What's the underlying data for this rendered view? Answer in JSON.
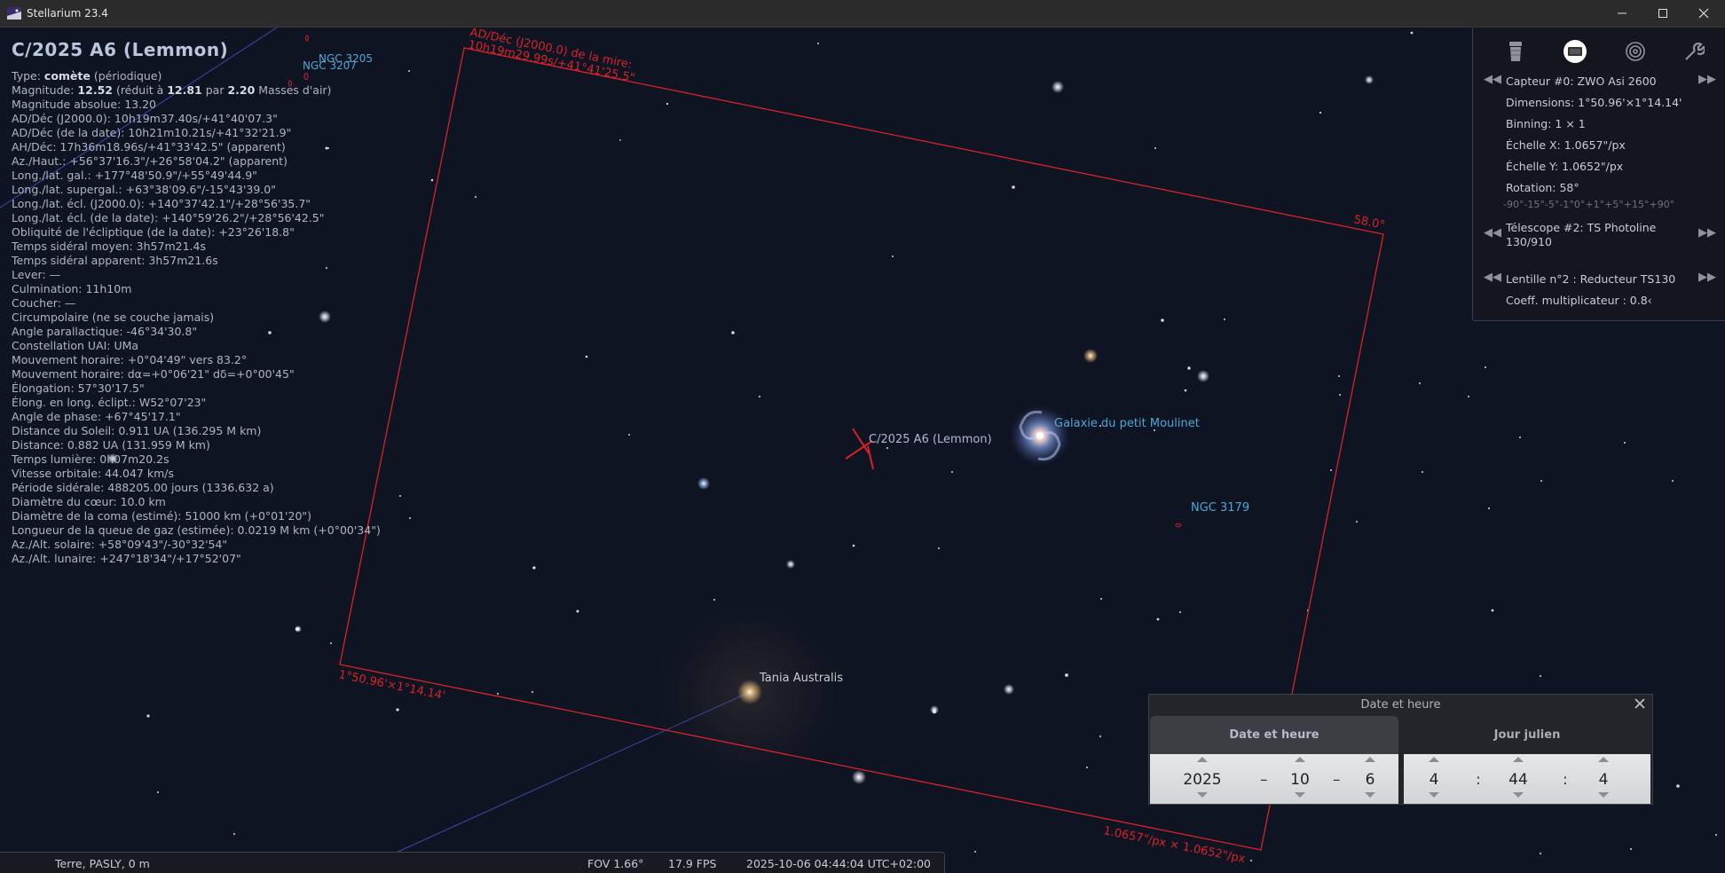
{
  "window": {
    "title": "Stellarium 23.4",
    "minimize": "—",
    "maximize": "☐",
    "close": "✕"
  },
  "object": {
    "title": "C/2025 A6 (Lemmon)",
    "lines": [
      [
        "Type: ",
        "comète",
        " (périodique)"
      ],
      [
        "Magnitude: ",
        "12.52",
        " (réduit à ",
        "12.81",
        " par ",
        "2.20",
        " Masses d'air)"
      ],
      [
        "Magnitude absolue: 13.20"
      ],
      [
        "AD/Déc (J2000.0): 10h19m37.40s/+41°40'07.3\""
      ],
      [
        "AD/Déc (de la date): 10h21m10.21s/+41°32'21.9\""
      ],
      [
        "AH/Déc: 17h36m18.96s/+41°33'42.5\" (apparent)"
      ],
      [
        "Az./Haut.: +56°37'16.3\"/+26°58'04.2\" (apparent)"
      ],
      [
        "Long./lat. gal.: +177°48'50.9\"/+55°49'44.9\""
      ],
      [
        "Long./lat. supergal.: +63°38'09.6\"/-15°43'39.0\""
      ],
      [
        "Long./lat. écl. (J2000.0): +140°37'42.1\"/+28°56'35.7\""
      ],
      [
        "Long./lat. écl. (de la date): +140°59'26.2\"/+28°56'42.5\""
      ],
      [
        "Obliquité de l'écliptique (de la date): +23°26'18.8\""
      ],
      [
        "Temps sidéral moyen: 3h57m21.4s"
      ],
      [
        "Temps sidéral apparent: 3h57m21.6s"
      ],
      [
        "Lever: —"
      ],
      [
        "Culmination: 11h10m"
      ],
      [
        "Coucher: —"
      ],
      [
        "Circumpolaire (ne se couche jamais)"
      ],
      [
        "Angle parallactique: -46°34'30.8\""
      ],
      [
        "Constellation UAI: UMa"
      ],
      [
        "Mouvement horaire: +0°04'49\" vers 83.2°"
      ],
      [
        "Mouvement horaire: dα=+0°06'21\" dδ=+0°00'45\""
      ],
      [
        "Élongation: 57°30'17.5\""
      ],
      [
        "Élong. en long. éclipt.: W52°07'23\""
      ],
      [
        "Angle de phase: +67°45'17.1\""
      ],
      [
        "Distance du Soleil: 0.911 UA (136.295 M km)"
      ],
      [
        "Distance: 0.882 UA (131.959 M km)"
      ],
      [
        "Temps lumière: 0h07m20.2s"
      ],
      [
        "Vitesse orbitale: 44.047 km/s"
      ],
      [
        "Période sidérale: 488205.00 jours (1336.632 a)"
      ],
      [
        "Diamètre du cœur: 10.0 km"
      ],
      [
        "Diamètre de la coma (estimé): 51000 km (+0°01'20\")"
      ],
      [
        "Longueur de la queue de gaz (estimée): 0.0219 M km (+0°00'34\")"
      ],
      [
        "Az./Alt. solaire: +58°09'43\"/-30°32'54\""
      ],
      [
        "Az./Alt. lunaire: +247°18'34\"/+17°52'07\""
      ]
    ]
  },
  "sky": {
    "labels": {
      "ngc3205": "NGC 3205",
      "ngc3207": "NGC 3207",
      "comet": "C/2025 A6 (Lemmon)",
      "galaxy": "Galaxie du petit Moulinet",
      "ngc3179": "NGC 3179",
      "tania": "Tania Australis"
    },
    "frame": {
      "target_line1": "AD/Déc (J2000.0) de la mire:",
      "target_line2": "10h19m29.99s/+41°41'25.5\"",
      "rotation": "58.0°",
      "dimensions": "1°50.96'×1°14.14'",
      "scale": "1.0657\"/px × 1.0652\"/px"
    },
    "colors": {
      "frame": "#d8222a",
      "dso_label": "#4ea6d6",
      "star_label": "#c8ccd4",
      "line": "#3b4aa8"
    }
  },
  "oculars": {
    "icons": [
      "ocular-icon",
      "ccd-icon",
      "telrad-icon",
      "wrench-icon"
    ],
    "sensor": "Capteur #0: ZWO Asi 2600",
    "dimensions": "Dimensions: 1°50.96'×1°14.14'",
    "binning": "Binning: 1 × 1",
    "scale_x": "Échelle X: 1.0657\"/px",
    "scale_y": "Échelle Y: 1.0652\"/px",
    "rotation": "Rotation: 58°",
    "rotation_scale": "-90°-15°-5°-1°0°+1°+5°+15°+90°",
    "telescope_line1": "Télescope #2: TS Photoline",
    "telescope_line2": "130/910",
    "lens": "Lentille n°2 : Reducteur TS130",
    "multiplier": "Coeff. multiplicateur : 0.8‹"
  },
  "date_dialog": {
    "title": "Date et heure",
    "tab_date": "Date et heure",
    "tab_julian": "Jour julien",
    "year": "2025",
    "month": "10",
    "day": "6",
    "hour": "4",
    "minute": "44",
    "second": "4",
    "date_sep": "–",
    "time_sep": ":",
    "close": "✕"
  },
  "status": {
    "location": "Terre, PASLY, 0 m",
    "fov": "FOV 1.66°",
    "fps": "17.9 FPS",
    "datetime": "2025-10-06 04:44:04 UTC+02:00"
  }
}
